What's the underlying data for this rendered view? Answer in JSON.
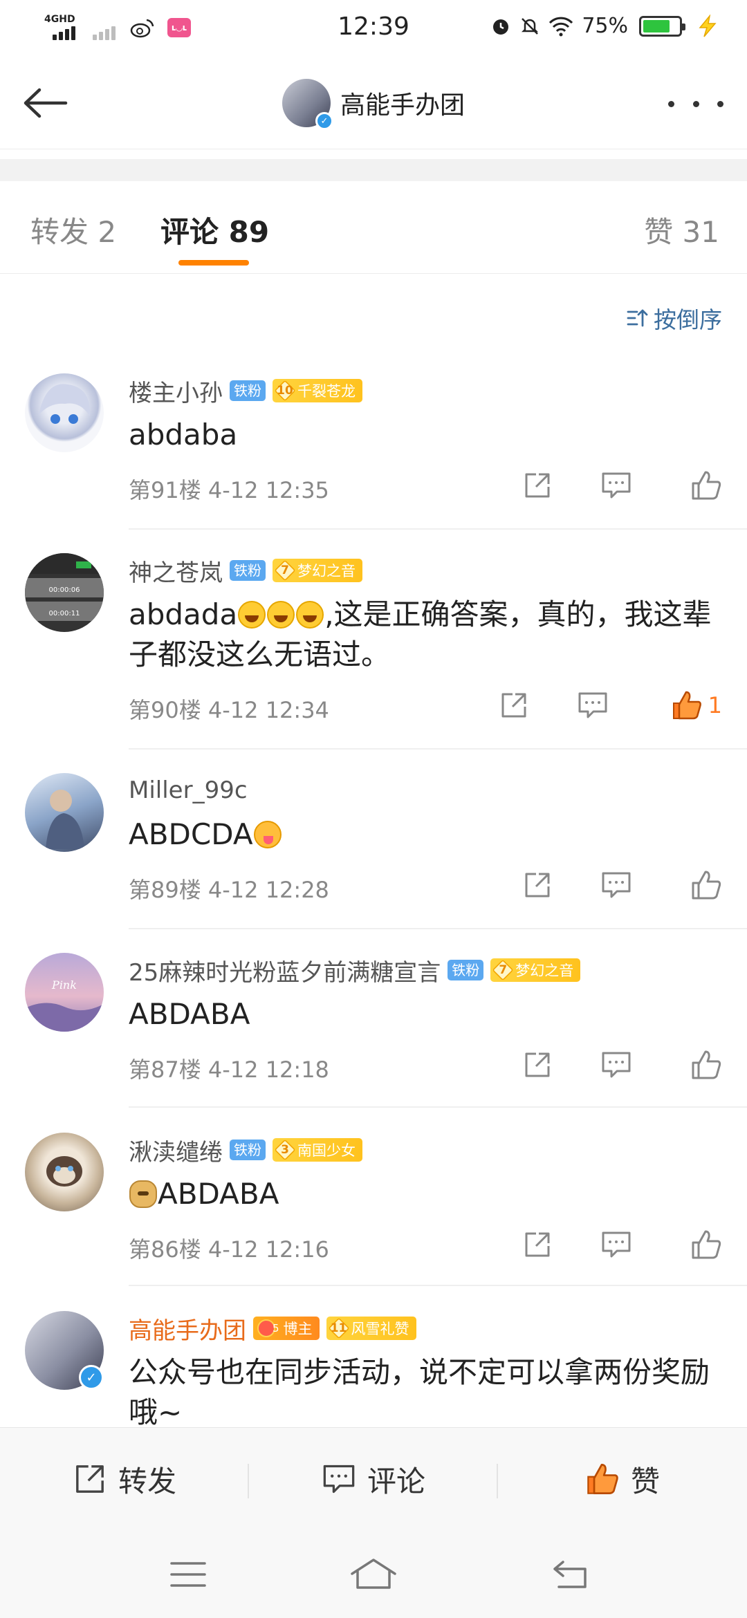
{
  "status_bar": {
    "network": "4GHD",
    "time": "12:39",
    "battery_percent": "75%",
    "battery_level": 0.75,
    "icons": [
      "signal-icon",
      "signal-dim-icon",
      "weibo-icon",
      "app-icon",
      "alarm-icon",
      "mute-icon",
      "wifi-icon",
      "battery-icon",
      "charging-icon"
    ]
  },
  "header": {
    "title": "高能手办团",
    "back_icon": "arrow-left-icon",
    "more_icon": "more-icon"
  },
  "tabs": {
    "repost": "转发 2",
    "comments": "评论 89",
    "likes": "赞 31",
    "active": "comments",
    "accent_color": "#ff8200"
  },
  "sort": {
    "label": "按倒序"
  },
  "comments": [
    {
      "name": "楼主小孙",
      "fan_badge": "铁粉",
      "level": "10",
      "level_title": "千裂苍龙",
      "text": "abdaba",
      "floor_time": "第91楼 4-12 12:35",
      "likes": ""
    },
    {
      "name": "神之苍岚",
      "fan_badge": "铁粉",
      "level": "7",
      "level_title": "梦幻之音",
      "text_before": "abdada",
      "text_after": ",这是正确答案，真的，我这辈子都没这么无语过。",
      "floor_time": "第90楼 4-12 12:34",
      "likes": "1",
      "liked": true
    },
    {
      "name": "Miller_99c",
      "text": "ABDCDA",
      "floor_time": "第89楼 4-12 12:28",
      "likes": ""
    },
    {
      "name": "25麻辣时光粉蓝夕前满糖宣言",
      "fan_badge": "铁粉",
      "level": "7",
      "level_title": "梦幻之音",
      "text": "ABDABA",
      "floor_time": "第87楼 4-12 12:18",
      "likes": ""
    },
    {
      "name": "湫渎缱绻",
      "fan_badge": "铁粉",
      "level": "3",
      "level_title": "南国少女",
      "text": "ABDABA",
      "floor_time": "第86楼 4-12 12:16",
      "likes": ""
    },
    {
      "name": "高能手办团",
      "host_badge": "博主",
      "host_level": "5",
      "level": "11",
      "level_title": "风雪礼赞",
      "text": "公众号也在同步活动，说不定可以拿两份奖励哦~"
    }
  ],
  "bottom_bar": {
    "repost": "转发",
    "comment": "评论",
    "like": "赞",
    "like_color": "#ff7b23"
  },
  "nav_bar": {
    "icons": [
      "menu-icon",
      "home-icon",
      "back-icon"
    ]
  }
}
